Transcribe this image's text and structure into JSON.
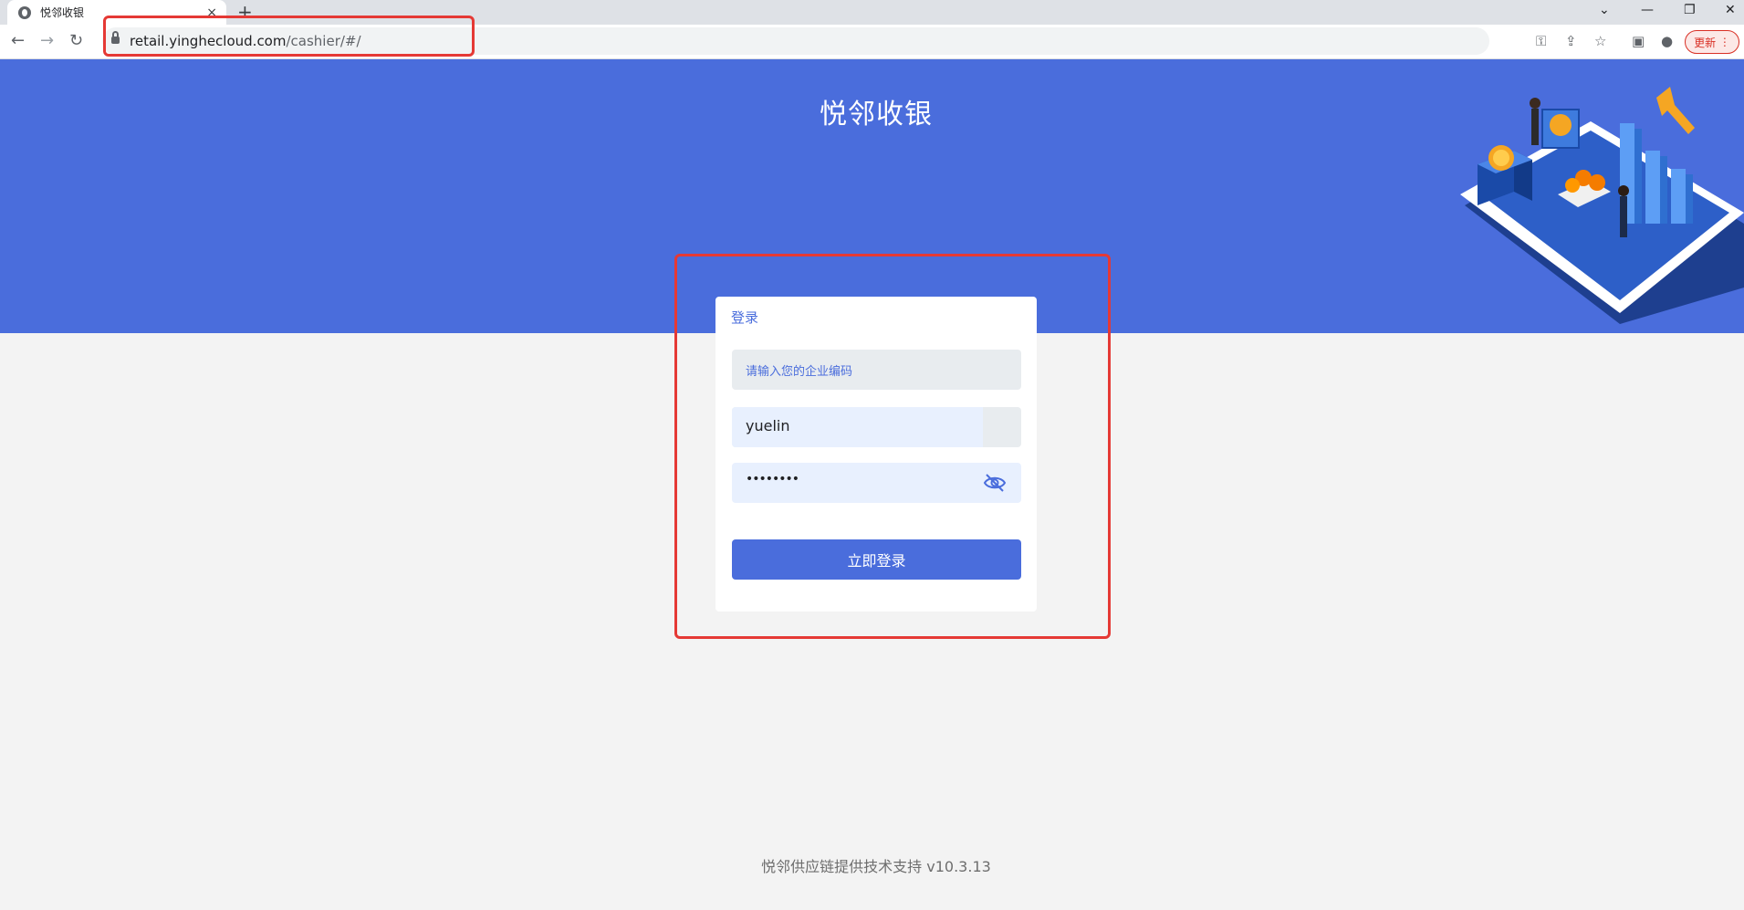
{
  "browser": {
    "tab_title": "悦邻收银",
    "tab_close": "×",
    "new_tab": "+",
    "url_host": "retail.yinghecloud.com",
    "url_path": "/cashier/#/",
    "update_label": "更新",
    "icons": [
      "back-icon",
      "forward-icon",
      "reload-icon",
      "lock-icon",
      "key-icon",
      "share-icon",
      "star-icon",
      "side-panel-icon",
      "profile-icon",
      "menu-icon"
    ]
  },
  "page": {
    "brand_title": "悦邻收银",
    "login": {
      "title": "登录",
      "company_code_placeholder": "请输入您的企业编码",
      "username_value": "yuelin",
      "password_value": "••••••••",
      "submit_label": "立即登录"
    },
    "footer": "悦邻供应链提供技术支持 v10.3.13"
  },
  "colors": {
    "brand_blue": "#4a6ddc",
    "highlight_red": "#e53935",
    "page_bg": "#f3f3f3"
  }
}
